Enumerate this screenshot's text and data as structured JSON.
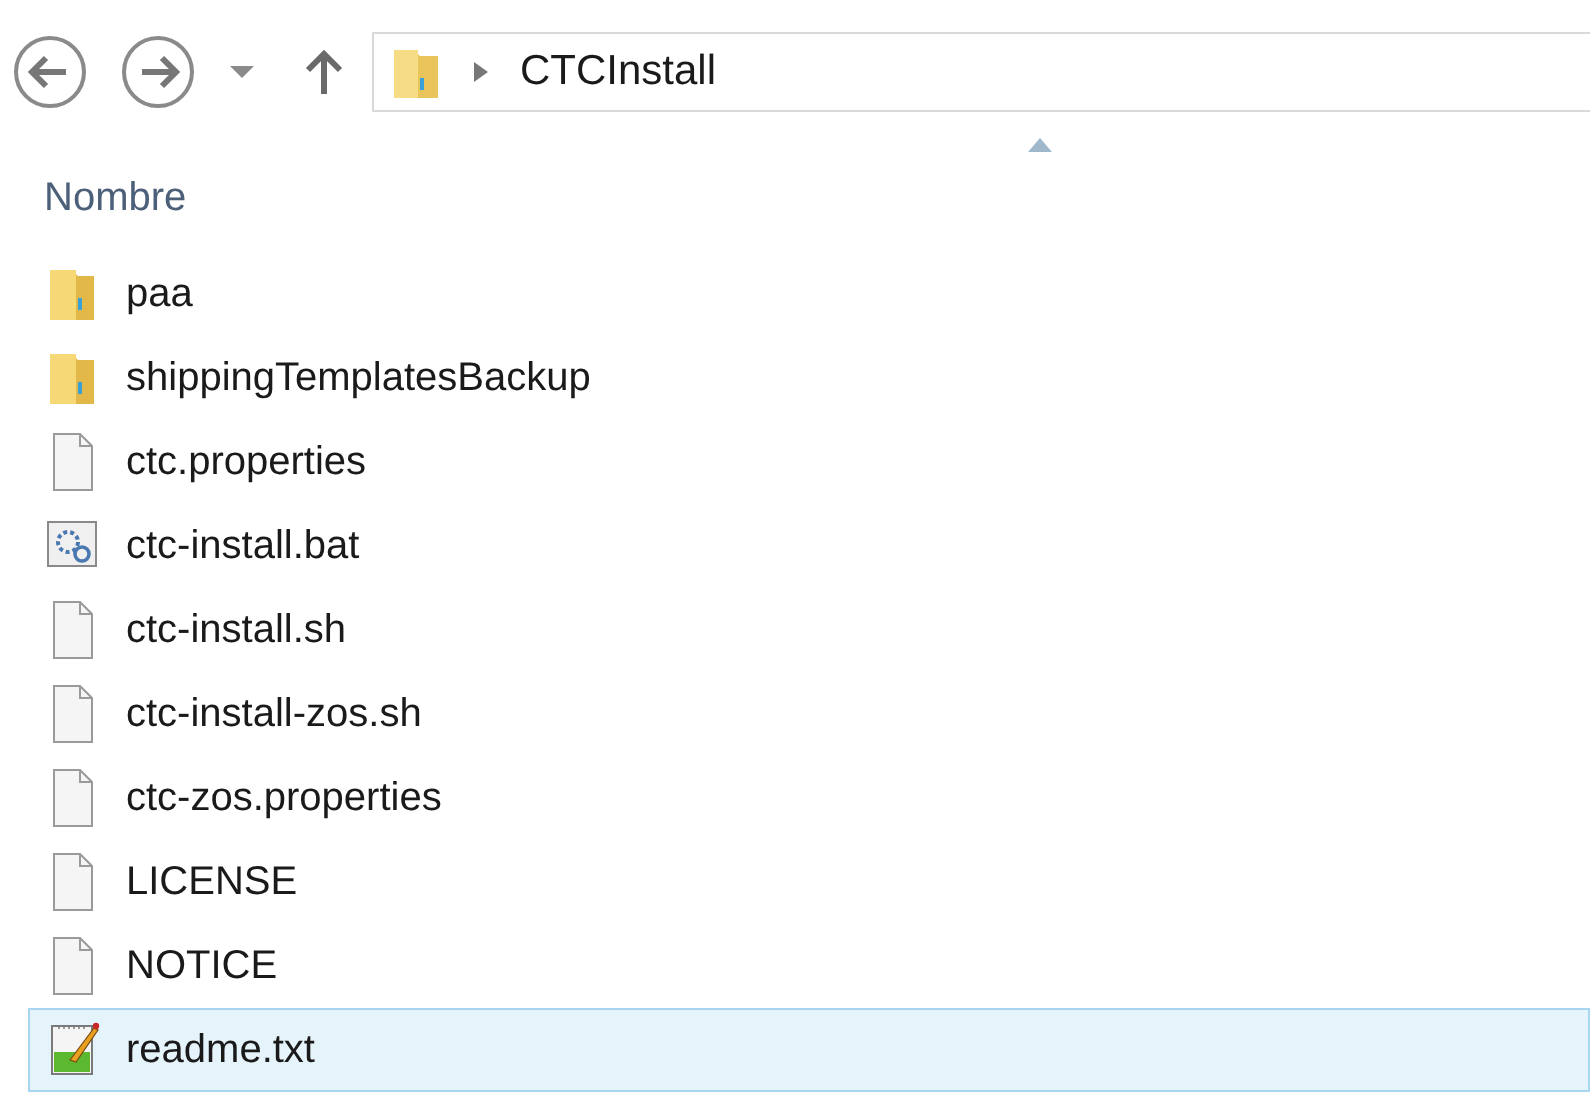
{
  "address_bar": {
    "path": "CTCInstall"
  },
  "column_header": {
    "label": "Nombre",
    "sort_ascending": true
  },
  "files": [
    {
      "name": "paa",
      "kind": "folder",
      "selected": false
    },
    {
      "name": "shippingTemplatesBackup",
      "kind": "folder",
      "selected": false
    },
    {
      "name": "ctc.properties",
      "kind": "file",
      "selected": false
    },
    {
      "name": "ctc-install.bat",
      "kind": "batch",
      "selected": false
    },
    {
      "name": "ctc-install.sh",
      "kind": "file",
      "selected": false
    },
    {
      "name": "ctc-install-zos.sh",
      "kind": "file",
      "selected": false
    },
    {
      "name": "ctc-zos.properties",
      "kind": "file",
      "selected": false
    },
    {
      "name": "LICENSE",
      "kind": "file",
      "selected": false
    },
    {
      "name": "NOTICE",
      "kind": "file",
      "selected": false
    },
    {
      "name": "readme.txt",
      "kind": "text",
      "selected": true
    }
  ]
}
